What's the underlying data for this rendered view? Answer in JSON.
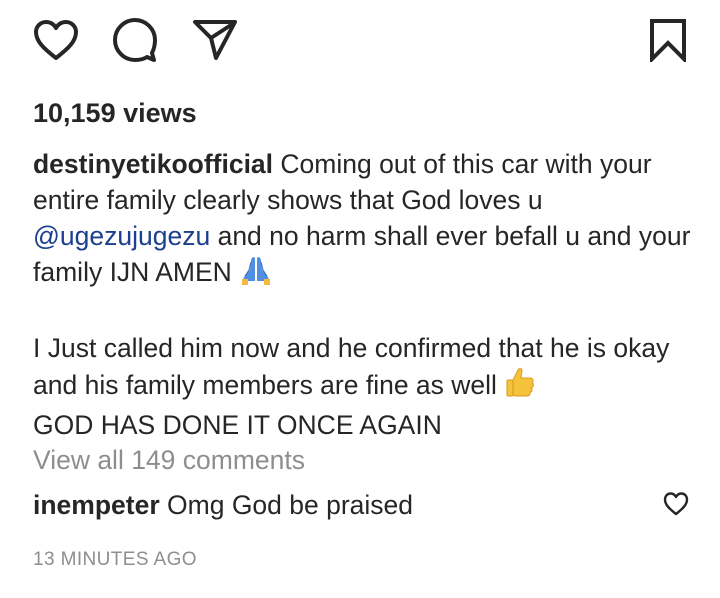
{
  "actions": {
    "like_icon": "heart-icon",
    "comment_icon": "comment-bubble-icon",
    "share_icon": "paper-plane-icon",
    "save_icon": "bookmark-icon"
  },
  "views_text": "10,159 views",
  "caption": {
    "username": "destinyetikoofficial",
    "text_part1": "Coming out of this car with your entire family clearly shows that God loves u",
    "mention": "@ugezujugezu",
    "text_part2": "and no harm shall ever befall u and your family IJN AMEN",
    "emoji_1": "folded-hands-emoji",
    "paragraph2_line1": "I Just called him now and he confirmed that he is okay and his family members are fine as well",
    "emoji_2": "thumbs-up-emoji",
    "paragraph2_line2": "GOD HAS DONE IT ONCE AGAIN"
  },
  "view_all_comments": "View all 149 comments",
  "comment": {
    "username": "inempeter",
    "text": "Omg God be praised",
    "like_icon": "heart-outline-icon"
  },
  "timestamp": "13 MINUTES AGO",
  "colors": {
    "text": "#262626",
    "muted": "#8e8e8e",
    "mention": "#1c3f8f"
  }
}
